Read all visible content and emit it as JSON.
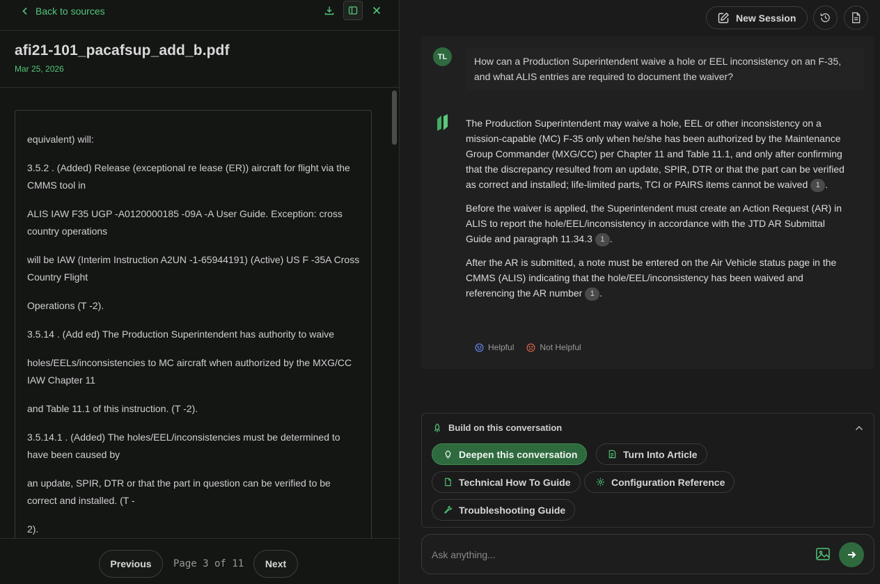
{
  "viewer": {
    "back_label": "Back to sources",
    "doc_title": "afi21-101_pacafsup_add_b.pdf",
    "doc_date": "Mar 25, 2026",
    "paragraphs": [
      "equivalent) will:",
      "3.5.2 . (Added) Release (exceptional re lease (ER)) aircraft for flight via the CMMS tool in",
      "ALIS IAW F35 UGP -A0120000185 -09A -A User Guide. Exception: cross country operations",
      "will be IAW (Interim Instruction A2UN -1-65944191) (Active) US F -35A Cross Country Flight",
      "Operations (T -2).",
      "3.5.14 . (Add ed) The Production Superintendent has authority to waive",
      "holes/EELs/inconsistencies to MC aircraft when authorized by the MXG/CC IAW Chapter 11",
      "and Table 11.1 of this instruction. (T -2).",
      "3.5.14.1 . (Added) The holes/EEL/inconsistencies must be determined to have been caused by",
      "an update, SPIR, DTR or that the part in question can be verified to be correct and installed. (T -",
      "2)."
    ],
    "pager": {
      "previous_label": "Previous",
      "page_label": "Page 3 of 11",
      "next_label": "Next"
    }
  },
  "header": {
    "new_session_label": "New Session"
  },
  "conversation": {
    "user_initials": "TL",
    "user_question": "How can a Production Superintendent waive a hole or EEL inconsistency on an F-35, and what ALIS entries are required to document the waiver?",
    "answer": [
      {
        "text": "The Production Superintendent may waive a hole, EEL or other inconsistency on a mission-capable (MC) F-35 only when he/she has been authorized by the Maintenance Group Commander (MXG/CC) per Chapter 11 and Table 11.1, and only after confirming that the discrepancy resulted from an update, SPIR, DTR or that the part can be verified as correct and installed; life-limited parts, TCI or PAIRS items cannot be waived",
        "cite": "1"
      },
      {
        "text": "Before the waiver is applied, the Superintendent must create an Action Request (AR) in ALIS to report the hole/EEL/inconsistency in accordance with the JTD AR Submittal Guide and paragraph 11.34.3",
        "cite": "1"
      },
      {
        "text": "After the AR is submitted, a note must be entered on the Air Vehicle status page in the CMMS (ALIS) indicating that the hole/EEL/inconsistency has been waived and referencing the AR number",
        "cite": "1"
      }
    ],
    "helpful_label": "Helpful",
    "not_helpful_label": "Not Helpful"
  },
  "build": {
    "title": "Build on this conversation",
    "chips": [
      {
        "label": "Deepen this conversation",
        "icon": "lightbulb-icon",
        "active": true
      },
      {
        "label": "Turn Into Article",
        "icon": "article-icon"
      },
      {
        "label": "Technical How To Guide",
        "icon": "document-icon"
      },
      {
        "label": "Configuration Reference",
        "icon": "gear-icon"
      },
      {
        "label": "Troubleshooting Guide",
        "icon": "wrench-icon"
      }
    ]
  },
  "composer": {
    "placeholder": "Ask anything..."
  },
  "colors": {
    "accent": "#55c47a",
    "accent_dark": "#2f6a3f"
  }
}
